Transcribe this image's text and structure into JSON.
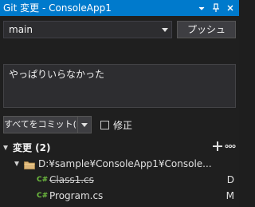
{
  "window": {
    "title": "Git 変更 - ConsoleApp1"
  },
  "branch": {
    "selected": "main"
  },
  "push": {
    "label": "プッシュ"
  },
  "commit": {
    "message": "やっぱりいらなかった",
    "button_label": "すべてをコミット(I)",
    "amend_label": "修正",
    "amend_checked": false
  },
  "changes": {
    "header": "変更 (2)",
    "folder_path": "D:¥sample¥ConsoleApp1¥Console...",
    "files": [
      {
        "icon": "C#",
        "name": "Class1.cs",
        "status": "D",
        "deleted": true
      },
      {
        "icon": "C#",
        "name": "Program.cs",
        "status": "M",
        "deleted": false
      }
    ]
  },
  "colors": {
    "titlebar": "#007acc",
    "background": "#1f1f1f",
    "folder": "#dcb67a",
    "csharp": "#6fbf3f"
  }
}
